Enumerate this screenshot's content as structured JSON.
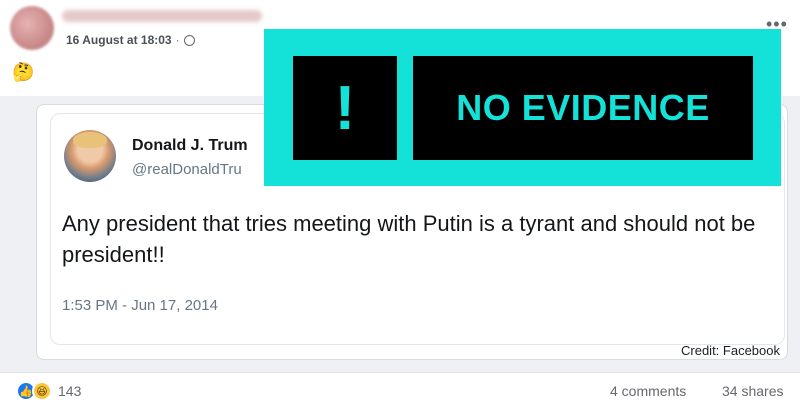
{
  "post": {
    "timestamp": "16 August at 18:03",
    "separator": "·",
    "body_emoji": "🤔",
    "more_icon": "more-options-icon",
    "globe_icon": "globe-icon"
  },
  "tweet": {
    "name": "Donald J. Trum",
    "handle": "@realDonaldTru",
    "text": "Any president that tries meeting with Putin is a tyrant and should not be president!!",
    "time": "1:53 PM - Jun 17, 2014"
  },
  "badge": {
    "symbol": "!",
    "label": "NO EVIDENCE",
    "background_color": "#14e2d8",
    "box_color": "#000000"
  },
  "credit": "Credit: Facebook",
  "footer": {
    "reaction_icons": [
      "like-icon",
      "haha-icon"
    ],
    "reaction_count": "143",
    "comments": "4 comments",
    "shares": "34 shares"
  }
}
